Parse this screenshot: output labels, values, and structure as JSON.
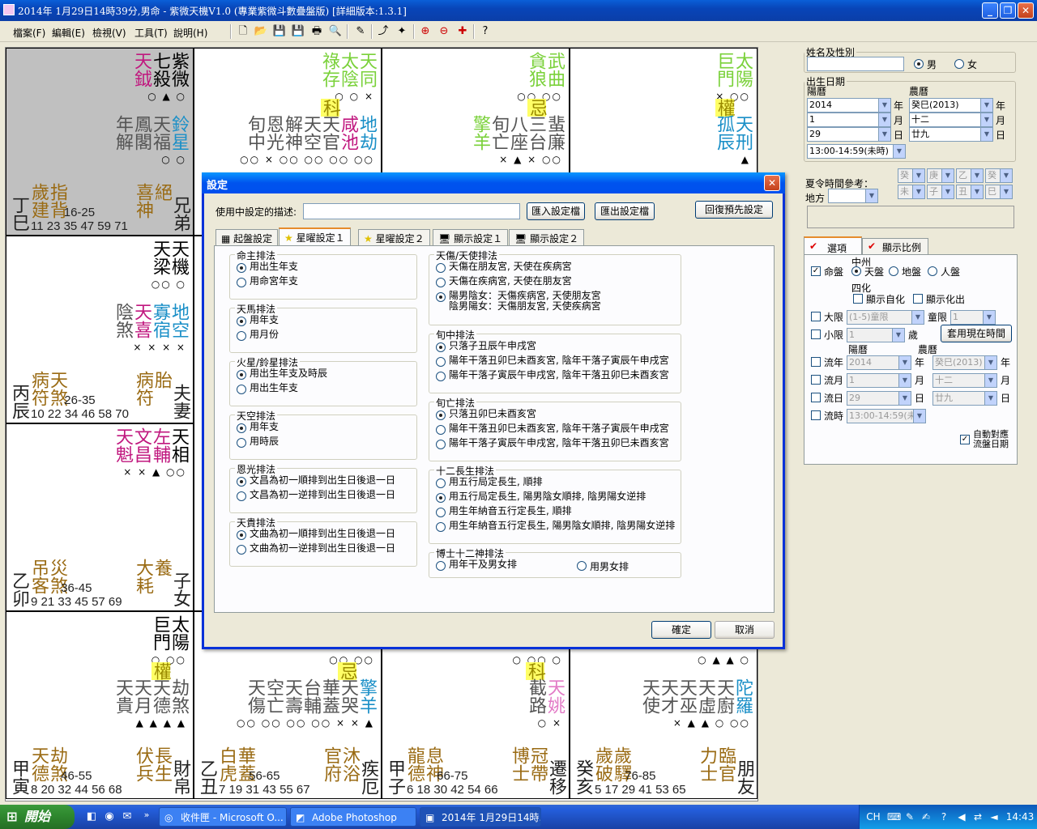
{
  "window": {
    "title": "2014年 1月29日14時39分,男命 - 紫微天機V1.0 (專業紫微斗數疊盤版) [詳細版本:1.3.1]"
  },
  "menu": [
    "檔案(F)",
    "編輯(E)",
    "檢視(V)",
    "工具(T)",
    "說明(H)"
  ],
  "toolbar_icons": [
    "new-icon",
    "open-icon",
    "save-icon",
    "save-as-icon",
    "print-icon",
    "print-preview-icon",
    "pen-icon",
    "pick-icon",
    "highlight-icon",
    "zoom-in-icon",
    "zoom-out-icon",
    "target-icon",
    "help-icon"
  ],
  "palaces": [
    {
      "stars": [
        {
          "t": "紫微",
          "c": "#000"
        },
        {
          "t": "七殺",
          "c": "#000"
        },
        {
          "t": "天鉞",
          "c": "#c0177e"
        }
      ],
      "m1": "○ ▲ ○",
      "hl": "",
      "minor": [
        {
          "t": "鈴星",
          "c": "#1a8fc7"
        },
        {
          "t": "天福",
          "c": "#555"
        },
        {
          "t": "鳳閣",
          "c": "#555"
        },
        {
          "t": "年解",
          "c": "#555"
        }
      ],
      "m2": "○ ○",
      "gods": [
        {
          "t": "指背",
          "c": "#9a6b14"
        },
        {
          "t": "歲建",
          "c": "#9a6b14"
        }
      ],
      "gods2": [
        {
          "t": "絕",
          "c": "#9a6b14"
        },
        {
          "t": "喜神",
          "c": "#9a6b14"
        }
      ],
      "ages": "16-25\n11 23 35 47 59 71",
      "stem": "丁巳",
      "palace": "兄弟",
      "gray": true
    },
    {
      "stars": [
        {
          "t": "天同",
          "c": "#7ad13a"
        },
        {
          "t": "太陰",
          "c": "#7ad13a"
        },
        {
          "t": "祿存",
          "c": "#7ad13a"
        }
      ],
      "m1": "○ ○ ×",
      "hl": "科",
      "minor": [
        {
          "t": "地劫",
          "c": "#1a8fc7"
        },
        {
          "t": "咸池",
          "c": "#c0177e"
        },
        {
          "t": "天官",
          "c": "#555"
        },
        {
          "t": "天空",
          "c": "#555"
        },
        {
          "t": "解神",
          "c": "#555"
        },
        {
          "t": "恩光",
          "c": "#555"
        },
        {
          "t": "旬中",
          "c": "#555"
        }
      ],
      "m2": "○○ × ○○ ○○ ○○ ○○",
      "gods": [],
      "gods2": [],
      "ages": "",
      "stem": "",
      "palace": "",
      "gray": false
    },
    {
      "stars": [
        {
          "t": "武曲",
          "c": "#7ad13a"
        },
        {
          "t": "貪狼",
          "c": "#7ad13a"
        }
      ],
      "m1": "○○ ○○",
      "hl": "忌",
      "minor": [
        {
          "t": "蜚廉",
          "c": "#555"
        },
        {
          "t": "三台",
          "c": "#555"
        },
        {
          "t": "八座",
          "c": "#555"
        },
        {
          "t": "旬亡",
          "c": "#555"
        },
        {
          "t": "擎羊",
          "c": "#7ad13a"
        }
      ],
      "m2": "× ▲ × ○○",
      "gods": [],
      "gods2": [],
      "ages": "",
      "stem": "",
      "palace": "",
      "gray": false
    },
    {
      "stars": [
        {
          "t": "太陽",
          "c": "#7ad13a"
        },
        {
          "t": "巨門",
          "c": "#7ad13a"
        }
      ],
      "m1": "× ○○",
      "hl": "權",
      "minor": [
        {
          "t": "天刑",
          "c": "#1a8fc7"
        },
        {
          "t": "孤辰",
          "c": "#1a8fc7"
        }
      ],
      "m2": "▲",
      "gods": [],
      "gods2": [],
      "ages": "",
      "stem": "",
      "palace": "",
      "gray": false
    },
    {
      "stars": [
        {
          "t": "天機",
          "c": "#000"
        },
        {
          "t": "天梁",
          "c": "#000"
        }
      ],
      "m1": "○○ ○",
      "hl": "",
      "minor": [
        {
          "t": "地空",
          "c": "#1a8fc7"
        },
        {
          "t": "寡宿",
          "c": "#1a8fc7"
        },
        {
          "t": "天喜",
          "c": "#c0177e"
        },
        {
          "t": "陰煞",
          "c": "#555"
        }
      ],
      "m2": "× × × ×",
      "gods": [
        {
          "t": "天煞",
          "c": "#9a6b14"
        },
        {
          "t": "病符",
          "c": "#9a6b14"
        }
      ],
      "gods2": [
        {
          "t": "胎",
          "c": "#9a6b14"
        },
        {
          "t": "病符",
          "c": "#9a6b14"
        }
      ],
      "ages": "26-35\n10 22 34 46 58 70",
      "stem": "丙辰",
      "palace": "夫妻",
      "gray": false
    },
    {
      "stars": [
        {
          "t": "天相",
          "c": "#000"
        },
        {
          "t": "左輔",
          "c": "#c0177e"
        },
        {
          "t": "文昌",
          "c": "#c0177e"
        },
        {
          "t": "天魁",
          "c": "#c0177e"
        }
      ],
      "m1": "× × ▲ ○○",
      "hl": "",
      "minor": [],
      "m2": "",
      "gods": [
        {
          "t": "災煞",
          "c": "#9a6b14"
        },
        {
          "t": "吊客",
          "c": "#9a6b14"
        }
      ],
      "gods2": [
        {
          "t": "養",
          "c": "#9a6b14"
        },
        {
          "t": "大耗",
          "c": "#9a6b14"
        }
      ],
      "ages": "36-45\n9 21 33 45 57 69",
      "stem": "乙卯",
      "palace": "子女",
      "gray": false
    },
    {
      "stars": [
        {
          "t": "太陽",
          "c": "#000"
        },
        {
          "t": "巨門",
          "c": "#000"
        }
      ],
      "m1": "○ ○○",
      "hl": "權",
      "minor": [
        {
          "t": "劫煞",
          "c": "#555"
        },
        {
          "t": "天德",
          "c": "#555"
        },
        {
          "t": "天月",
          "c": "#555"
        },
        {
          "t": "天貴",
          "c": "#555"
        }
      ],
      "m2": "▲ ▲ ▲ ▲",
      "gods": [
        {
          "t": "劫煞",
          "c": "#9a6b14"
        },
        {
          "t": "天德",
          "c": "#9a6b14"
        }
      ],
      "gods2": [
        {
          "t": "長生",
          "c": "#9a6b14"
        },
        {
          "t": "伏兵",
          "c": "#9a6b14"
        }
      ],
      "ages": "46-55\n8 20 32 44 56 68",
      "stem": "甲寅",
      "palace": "財帛",
      "gray": false
    },
    {
      "stars": [],
      "m1": "○○ ○○",
      "hl": "忌",
      "minor": [
        {
          "t": "擎羊",
          "c": "#1a8fc7"
        },
        {
          "t": "天哭",
          "c": "#555"
        },
        {
          "t": "華蓋",
          "c": "#555"
        },
        {
          "t": "台輔",
          "c": "#555"
        },
        {
          "t": "天壽",
          "c": "#555"
        },
        {
          "t": "空亡",
          "c": "#555"
        },
        {
          "t": "天傷",
          "c": "#555"
        }
      ],
      "m2": "○○ ○○ ○○ ○○ × × ▲",
      "gods": [
        {
          "t": "華蓋",
          "c": "#9a6b14"
        },
        {
          "t": "白虎",
          "c": "#9a6b14"
        }
      ],
      "gods2": [
        {
          "t": "沐浴",
          "c": "#9a6b14"
        },
        {
          "t": "官府",
          "c": "#9a6b14"
        }
      ],
      "ages": "56-65\n7 19 31 43 55 67",
      "stem": "乙丑",
      "palace": "疾厄",
      "gray": false
    },
    {
      "stars": [],
      "m1": "○ ○○ ○",
      "hl": "科",
      "minor": [
        {
          "t": "天姚",
          "c": "#e27ac6"
        },
        {
          "t": "截路",
          "c": "#555"
        }
      ],
      "m2": "○ ×",
      "gods": [
        {
          "t": "息神",
          "c": "#9a6b14"
        },
        {
          "t": "龍德",
          "c": "#9a6b14"
        }
      ],
      "gods2": [
        {
          "t": "冠帶",
          "c": "#9a6b14"
        },
        {
          "t": "博士",
          "c": "#9a6b14"
        }
      ],
      "ages": "66-75\n6 18 30 42 54 66",
      "stem": "甲子",
      "palace": "遷移",
      "gray": false
    },
    {
      "stars": [],
      "m1": "○ ▲ ▲ ○",
      "hl": "",
      "minor": [
        {
          "t": "陀羅",
          "c": "#1a8fc7"
        },
        {
          "t": "天廚",
          "c": "#555"
        },
        {
          "t": "天虛",
          "c": "#555"
        },
        {
          "t": "天巫",
          "c": "#555"
        },
        {
          "t": "天才",
          "c": "#555"
        },
        {
          "t": "天使",
          "c": "#555"
        }
      ],
      "m2": "× ▲ ▲ ○ ○○",
      "gods": [
        {
          "t": "歲驛",
          "c": "#9a6b14"
        },
        {
          "t": "歲破",
          "c": "#9a6b14"
        }
      ],
      "gods2": [
        {
          "t": "臨官",
          "c": "#9a6b14"
        },
        {
          "t": "力士",
          "c": "#9a6b14"
        }
      ],
      "ages": "76-85\n5 17 29 41 53 65",
      "stem": "癸亥",
      "palace": "朋友",
      "gray": false
    }
  ],
  "right": {
    "name_legend": "姓名及性別",
    "name_value": "",
    "male": "男",
    "female": "女",
    "birth_legend": "出生日期",
    "solar": "陽曆",
    "lunar": "農曆",
    "year": "2014",
    "month": "1",
    "day": "29",
    "lyear": "癸巳(2013)",
    "lmonth": "十二",
    "lday": "廿九",
    "u_year": "年",
    "u_month": "月",
    "u_day": "日",
    "hour": "13:00-14:59(未時)",
    "dst": "夏令時間參考：",
    "place": "地方",
    "gz": [
      "癸",
      "庚",
      "乙",
      "癸",
      "未",
      "子",
      "丑",
      "巳"
    ],
    "tab_opt": "選項",
    "tab_scale": "顯示比例",
    "mingpan": "命盤",
    "zhongzhou": "中州",
    "tianpan": "天盤",
    "dipan": "地盤",
    "renpan": "人盤",
    "sihua": "四化",
    "zihua": "顯示自化",
    "huachu": "顯示化出",
    "daxian": "大限",
    "daxian_val": "(1-5)童限",
    "tongxian": "童限",
    "tongxian_val": "1",
    "xiaoxian": "小限",
    "xiaoxian_val": "1",
    "sui": "歲",
    "now_btn": "套用現在時間",
    "liunian": "流年",
    "liuyue": "流月",
    "liuri": "流日",
    "liushi": "流時",
    "ln_y": "2014",
    "ln_ly": "癸巳(2013)",
    "ln_m": "1",
    "ln_lm": "十二",
    "ln_d": "29",
    "ln_ld": "廿九",
    "ln_h": "13:00-14:59(未時)",
    "auto": "自動對應\n流盤日期"
  },
  "dialog": {
    "title": "設定",
    "desc_label": "使用中設定的描述:",
    "desc_value": "",
    "btn_import": "匯入設定檔",
    "btn_export": "匯出設定檔",
    "btn_reset": "回復預先設定",
    "tabs": [
      "起盤設定",
      "星曜設定１",
      "星曜設定２",
      "顯示設定１",
      "顯示設定２"
    ],
    "left_groups": [
      {
        "title": "命主排法",
        "opts": [
          "用出生年支",
          "用命宮年支"
        ],
        "sel": 0
      },
      {
        "title": "天馬排法",
        "opts": [
          "用年支",
          "用月份"
        ],
        "sel": 0
      },
      {
        "title": "火星/鈴星排法",
        "opts": [
          "用出生年支及時辰",
          "用出生年支"
        ],
        "sel": 0
      },
      {
        "title": "天空排法",
        "opts": [
          "用年支",
          "用時辰"
        ],
        "sel": 0
      },
      {
        "title": "恩光排法",
        "opts": [
          "文昌為初一順排到出生日後退一日",
          "文昌為初一逆排到出生日後退一日"
        ],
        "sel": 0
      },
      {
        "title": "天貴排法",
        "opts": [
          "文曲為初一順排到出生日後退一日",
          "文曲為初一逆排到出生日後退一日"
        ],
        "sel": 0
      }
    ],
    "right_groups": [
      {
        "title": "天傷/天使排法",
        "opts": [
          "天傷在朋友宮, 天使在疾病宮",
          "天傷在疾病宮, 天使在朋友宮",
          "陽男陰女：天傷疾病宮, 天使朋友宮\n陰男陽女：天傷朋友宮, 天使疾病宮"
        ],
        "sel": 2
      },
      {
        "title": "旬中排法",
        "opts": [
          "只落子丑辰午申戌宮",
          "陽年干落丑卯巳未酉亥宮, 陰年干落子寅辰午申戌宮",
          "陽年干落子寅辰午申戌宮, 陰年干落丑卯巳未酉亥宮"
        ],
        "sel": 0
      },
      {
        "title": "旬亡排法",
        "opts": [
          "只落丑卯巳未酉亥宮",
          "陽年干落丑卯巳未酉亥宮, 陰年干落子寅辰午申戌宮",
          "陽年干落子寅辰午申戌宮, 陰年干落丑卯巳未酉亥宮"
        ],
        "sel": 0
      },
      {
        "title": "十二長生排法",
        "opts": [
          "用五行局定長生, 順排",
          "用五行局定長生, 陽男陰女順排, 陰男陽女逆排",
          "用生年納音五行定長生, 順排",
          "用生年納音五行定長生, 陽男陰女順排, 陰男陽女逆排"
        ],
        "sel": 1
      },
      {
        "title": "博士十二神排法",
        "opts": [
          "用年干及男女排",
          "用男女排"
        ],
        "sel": 0
      }
    ],
    "ok": "確定",
    "cancel": "取消"
  },
  "taskbar": {
    "start": "開始",
    "tasks": [
      "收件匣 - Microsoft O...",
      "Adobe Photoshop",
      "2014年 1月29日14時..."
    ],
    "lang": "CH",
    "time": "14:43"
  }
}
